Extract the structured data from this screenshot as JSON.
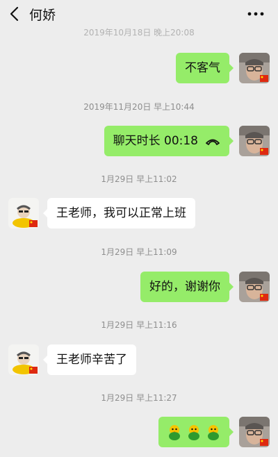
{
  "header": {
    "title": "何娇"
  },
  "icons": {
    "back": "chevron-left-icon",
    "more": "more-dots-icon",
    "call": "phone-hangup-icon",
    "emoji": "chick-emoji-icon",
    "flag": "china-flag-badge"
  },
  "colors": {
    "background": "#ededed",
    "outgoing_bubble": "#95ec69",
    "incoming_bubble": "#ffffff",
    "timestamp": "#8e8e8e"
  },
  "messages": [
    {
      "type": "timestamp",
      "text": "2019年10月18日 晚上20:08"
    },
    {
      "type": "text",
      "direction": "out",
      "text": "不客气"
    },
    {
      "type": "timestamp",
      "text": "2019年11月20日 早上10:44"
    },
    {
      "type": "call",
      "direction": "out",
      "text": "聊天时长 00:18"
    },
    {
      "type": "timestamp",
      "text": "1月29日 早上11:02"
    },
    {
      "type": "text",
      "direction": "in",
      "text": "王老师，我可以正常上班"
    },
    {
      "type": "timestamp",
      "text": "1月29日 早上11:09"
    },
    {
      "type": "text",
      "direction": "out",
      "text": "好的，谢谢你"
    },
    {
      "type": "timestamp",
      "text": "1月29日 早上11:16"
    },
    {
      "type": "text",
      "direction": "in",
      "text": "王老师辛苦了"
    },
    {
      "type": "timestamp",
      "text": "1月29日 早上11:27"
    },
    {
      "type": "emoji",
      "direction": "out",
      "emoji_count": 3
    }
  ]
}
